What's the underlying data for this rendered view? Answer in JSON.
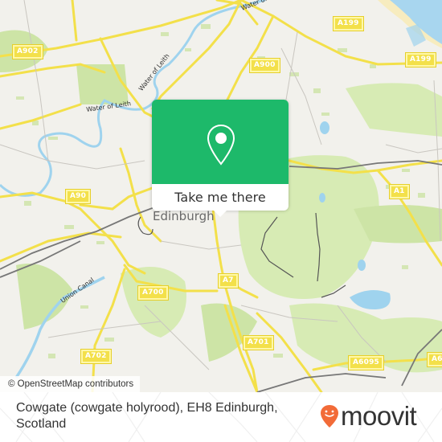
{
  "map": {
    "city_label": "Edinburgh",
    "road_labels": [
      "A902",
      "A900",
      "A199",
      "A199",
      "A90",
      "A1",
      "A7",
      "A700",
      "A702",
      "A701",
      "A6095",
      "A6"
    ],
    "water_labels": [
      "Water of Leith",
      "Water of Leith",
      "Water of Leith",
      "Union Canal"
    ],
    "colors": {
      "land": "#f2f1ec",
      "park": "#d7ebb4",
      "residential": "#cde4a6",
      "water": "#9fd3ee",
      "road": "#f3e04a",
      "rail": "#777777",
      "sea": "#a8d6ef",
      "beach": "#f7ecbf"
    }
  },
  "popup": {
    "button_label": "Take me there",
    "icon": "map-pin-icon",
    "color": "#1db96a"
  },
  "attribution": "© OpenStreetMap contributors",
  "footer": {
    "address": "Cowgate (cowgate holyrood), EH8 Edinburgh, Scotland",
    "brand": "moovit",
    "brand_color": "#f26b38"
  }
}
